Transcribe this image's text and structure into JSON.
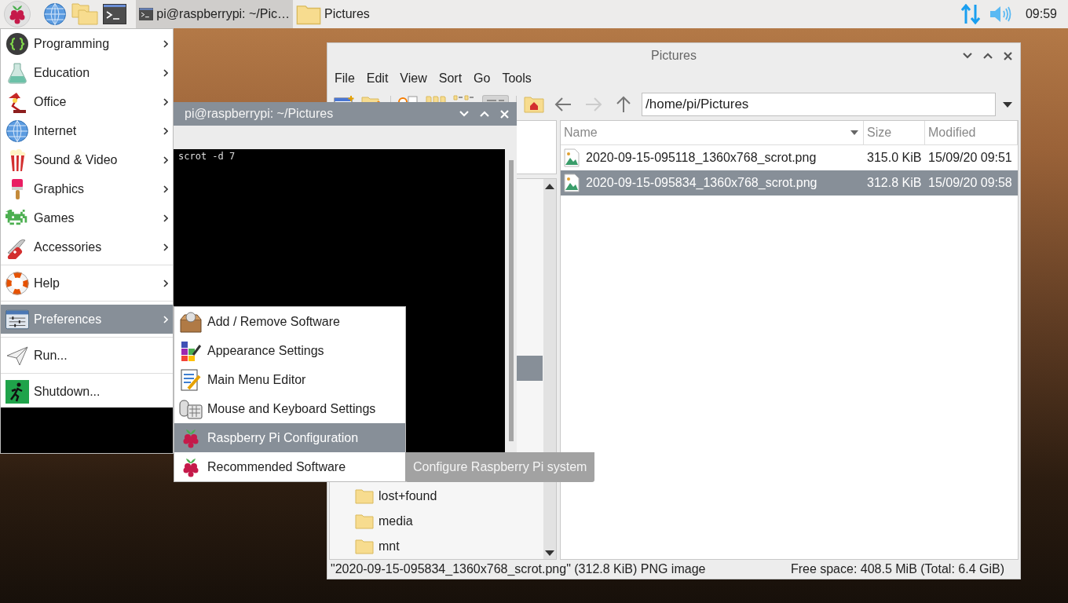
{
  "taskbar": {
    "tasks": [
      {
        "kind": "terminal",
        "label": "pi@raspberrypi: ~/Pic…",
        "selected": true
      },
      {
        "kind": "folder",
        "label": "Pictures",
        "selected": false
      }
    ],
    "clock": "09:59"
  },
  "file_manager": {
    "title": "Pictures",
    "menu": [
      "File",
      "Edit",
      "View",
      "Sort",
      "Go",
      "Tools"
    ],
    "path": "/home/pi/Pictures",
    "columns": [
      {
        "label": "Name",
        "sorted": true
      },
      {
        "label": "Size",
        "sorted": false
      },
      {
        "label": "Modified",
        "sorted": false
      }
    ],
    "files": [
      {
        "name": "2020-09-15-095118_1360x768_scrot.png",
        "size": "315.0 KiB",
        "modified": "15/09/20 09:51",
        "selected": false
      },
      {
        "name": "2020-09-15-095834_1360x768_scrot.png",
        "size": "312.8 KiB",
        "modified": "15/09/20 09:58",
        "selected": true
      }
    ],
    "tree": [
      "lost+found",
      "media",
      "mnt"
    ],
    "status_left": "\"2020-09-15-095834_1360x768_scrot.png\" (312.8 KiB) PNG image",
    "status_right": "Free space: 408.5 MiB (Total: 6.4 GiB)"
  },
  "terminal": {
    "title": "pi@raspberrypi: ~/Pictures",
    "lines": [
      "scrot -d 7"
    ]
  },
  "main_menu": {
    "groups": [
      [
        {
          "kind": "braces",
          "label": "Programming",
          "submenu": true,
          "selected": false
        },
        {
          "kind": "flask",
          "label": "Education",
          "submenu": true,
          "selected": false
        },
        {
          "kind": "lamp",
          "label": "Office",
          "submenu": true,
          "selected": false
        },
        {
          "kind": "globe",
          "label": "Internet",
          "submenu": true,
          "selected": false
        },
        {
          "kind": "popcorn",
          "label": "Sound & Video",
          "submenu": true,
          "selected": false
        },
        {
          "kind": "brush",
          "label": "Graphics",
          "submenu": true,
          "selected": false
        },
        {
          "kind": "invader",
          "label": "Games",
          "submenu": true,
          "selected": false
        },
        {
          "kind": "knife",
          "label": "Accessories",
          "submenu": true,
          "selected": false
        }
      ],
      [
        {
          "kind": "lifebuoy",
          "label": "Help",
          "submenu": true,
          "selected": false
        }
      ],
      [
        {
          "kind": "sliders",
          "label": "Preferences",
          "submenu": true,
          "selected": true
        }
      ],
      [
        {
          "kind": "plane",
          "label": "Run...",
          "submenu": false,
          "selected": false
        }
      ],
      [
        {
          "kind": "exit",
          "label": "Shutdown...",
          "submenu": false,
          "selected": false
        }
      ]
    ]
  },
  "submenu": {
    "items": [
      {
        "kind": "box",
        "label": "Add / Remove Software",
        "selected": false
      },
      {
        "kind": "palette",
        "label": "Appearance Settings",
        "selected": false
      },
      {
        "kind": "editor",
        "label": "Main Menu Editor",
        "selected": false
      },
      {
        "kind": "keyboard",
        "label": "Mouse and Keyboard Settings",
        "selected": false
      },
      {
        "kind": "raspberry",
        "label": "Raspberry Pi Configuration",
        "selected": true
      },
      {
        "kind": "raspberry",
        "label": "Recommended Software",
        "selected": false
      }
    ]
  },
  "tooltip": "Configure Raspberry Pi system"
}
